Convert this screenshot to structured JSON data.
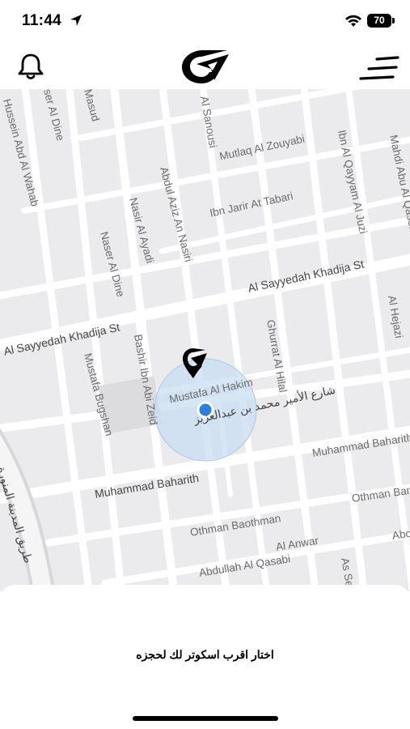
{
  "status_bar": {
    "time": "11:44",
    "battery": "70"
  },
  "header": {
    "bell_icon": "bell-icon",
    "logo_icon": "brand-logo-icon",
    "menu_icon": "menu-icon"
  },
  "map": {
    "streets": [
      "Hussein Abd Al Wahab",
      "ser Al Dine",
      "Masud",
      "Al Sanousi",
      "Mutlaq Al Zouyabi",
      "Ibn Al Qayyam Al Juzi",
      "Mahdi Abu Al Qasem",
      "Abdul Aziz An Nasiri",
      "Ibn Jarir At Tabari",
      "Nasir Al Ayadi",
      "Naser Al Dine",
      "Al Sayyedah Khadija St",
      "Al Sayyedah Khadija St",
      "Al Hejazi",
      "Ghurrat Al Hilal",
      "Bashir Ibn Abi Zeid",
      "Mustafa Bugshan",
      "Mustafa Al Hakim",
      "شارع الأمير محمد بن عبدالعزيز",
      "Muhammad Baharith",
      "Muhammad Baharith",
      "Othman Ban",
      "Othman Baothman",
      "Al Anwar",
      "Abdullah Al Qasabi",
      "As Se",
      "Abo",
      "طريق المدينة المنورة"
    ],
    "colors": {
      "road": "#ffffff",
      "block": "#ebebed",
      "accuracy": "#c9ddf1",
      "user_dot": "#2f7de1"
    }
  },
  "bottom_sheet": {
    "prompt": "اختار اقرب اسكوتر لك لحجزه"
  }
}
